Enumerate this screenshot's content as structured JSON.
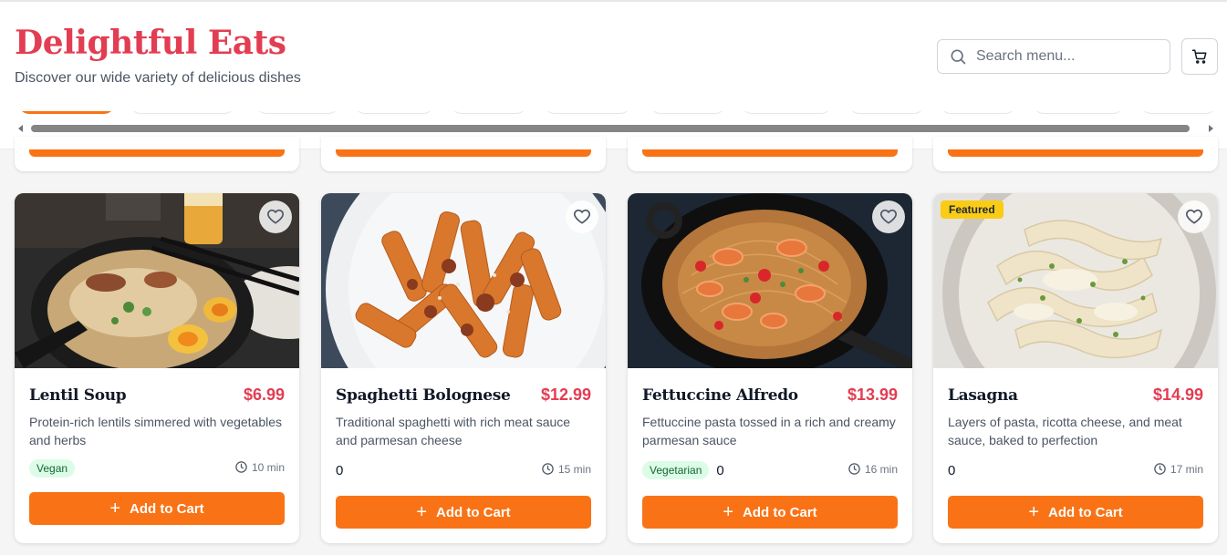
{
  "header": {
    "brand": "Delightful Eats",
    "tagline": "Discover our wide variety of delicious dishes",
    "search_placeholder": "Search menu...",
    "cart_icon": "shopping-cart-icon",
    "search_icon": "search-icon"
  },
  "colors": {
    "brand": "#e23d52",
    "accent": "#f97316",
    "featured": "#facc15",
    "badge_bg": "#dcfce7",
    "badge_text": "#166534"
  },
  "dishes": [
    {
      "name": "Lentil Soup",
      "price": "$6.99",
      "description": "Protein-rich lentils simmered with vegetables and herbs",
      "badge": "Vegan",
      "count": "",
      "time": "10 min",
      "featured": false,
      "add_label": "Add to Cart"
    },
    {
      "name": "Spaghetti Bolognese",
      "price": "$12.99",
      "description": "Traditional spaghetti with rich meat sauce and parmesan cheese",
      "badge": "",
      "count": "0",
      "time": "15 min",
      "featured": false,
      "add_label": "Add to Cart"
    },
    {
      "name": "Fettuccine Alfredo",
      "price": "$13.99",
      "description": "Fettuccine pasta tossed in a rich and creamy parmesan sauce",
      "badge": "Vegetarian",
      "count": "0",
      "time": "16 min",
      "featured": false,
      "add_label": "Add to Cart"
    },
    {
      "name": "Lasagna",
      "price": "$14.99",
      "description": "Layers of pasta, ricotta cheese, and meat sauce, baked to perfection",
      "badge": "",
      "count": "0",
      "time": "17 min",
      "featured": true,
      "featured_label": "Featured",
      "add_label": "Add to Cart"
    }
  ]
}
